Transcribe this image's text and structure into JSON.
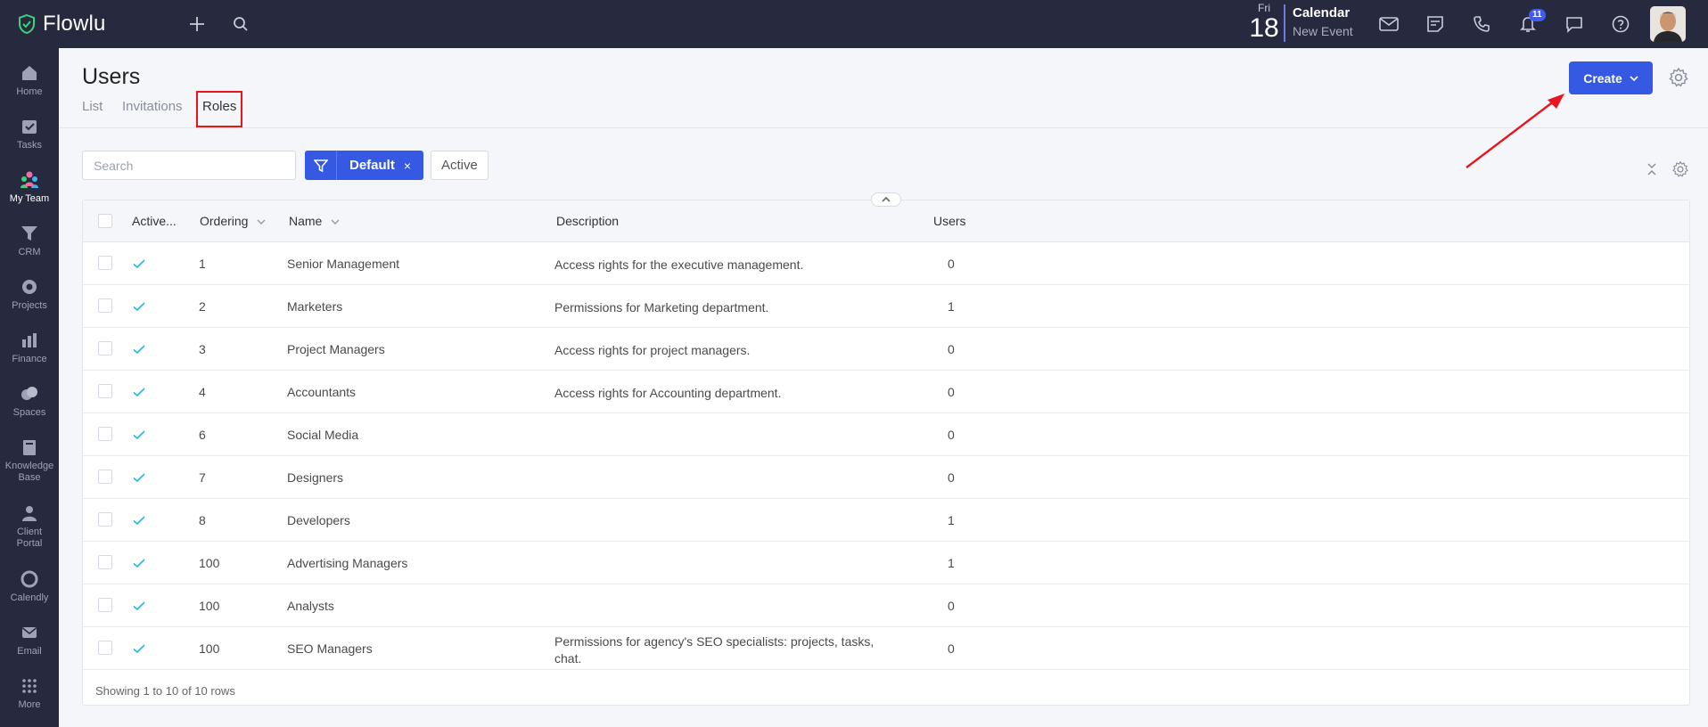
{
  "app": {
    "name": "Flowlu"
  },
  "topbar": {
    "calendar": {
      "day": "Fri",
      "date": "18",
      "title": "Calendar",
      "subtitle": "New Event"
    },
    "notification_count": "11"
  },
  "sidebar": {
    "items": [
      {
        "label": "Home",
        "icon": "home-icon"
      },
      {
        "label": "Tasks",
        "icon": "tasks-icon"
      },
      {
        "label": "My Team",
        "icon": "team-icon",
        "active": true
      },
      {
        "label": "CRM",
        "icon": "crm-icon"
      },
      {
        "label": "Projects",
        "icon": "projects-icon"
      },
      {
        "label": "Finance",
        "icon": "finance-icon"
      },
      {
        "label": "Spaces",
        "icon": "spaces-icon"
      },
      {
        "label": "Knowledge Base",
        "icon": "knowledge-base-icon"
      },
      {
        "label": "Client Portal",
        "icon": "client-portal-icon"
      },
      {
        "label": "Calendly",
        "icon": "calendly-icon"
      },
      {
        "label": "Email",
        "icon": "email-icon"
      },
      {
        "label": "More",
        "icon": "more-icon"
      }
    ]
  },
  "header": {
    "title": "Users",
    "tabs": [
      {
        "label": "List"
      },
      {
        "label": "Invitations"
      },
      {
        "label": "Roles",
        "active": true
      }
    ],
    "create_label": "Create"
  },
  "toolbar": {
    "search_placeholder": "Search",
    "filter_label": "Default",
    "filter_close": "×",
    "active_label": "Active"
  },
  "table": {
    "columns": {
      "active": "Active...",
      "ordering": "Ordering",
      "name": "Name",
      "description": "Description",
      "users": "Users"
    },
    "rows": [
      {
        "ordering": "1",
        "name": "Senior Management",
        "description": "Access rights for the executive management.",
        "description2": "",
        "users": "0"
      },
      {
        "ordering": "2",
        "name": "Marketers",
        "description": "Permissions for Marketing department.",
        "description2": "",
        "users": "1"
      },
      {
        "ordering": "3",
        "name": "Project Managers",
        "description": "Access rights for project managers.",
        "description2": "",
        "users": "0"
      },
      {
        "ordering": "4",
        "name": "Accountants",
        "description": "Access rights for Accounting department.",
        "description2": "",
        "users": "0"
      },
      {
        "ordering": "6",
        "name": "Social Media",
        "description": "",
        "description2": "",
        "users": "0"
      },
      {
        "ordering": "7",
        "name": "Designers",
        "description": "",
        "description2": "",
        "users": "0"
      },
      {
        "ordering": "8",
        "name": "Developers",
        "description": "",
        "description2": "",
        "users": "1"
      },
      {
        "ordering": "100",
        "name": "Advertising Managers",
        "description": "",
        "description2": "",
        "users": "1"
      },
      {
        "ordering": "100",
        "name": "Analysts",
        "description": "",
        "description2": "",
        "users": "0"
      },
      {
        "ordering": "100",
        "name": "SEO Managers",
        "description": "Permissions for agency's SEO specialists: projects, tasks,",
        "description2": "chat.",
        "users": "0"
      }
    ],
    "footer": "Showing 1 to 10 of 10 rows"
  },
  "colors": {
    "topbar": "#272a3f",
    "primary": "#3559e3",
    "check": "#2bb5d8",
    "highlight": "#e8161c"
  }
}
